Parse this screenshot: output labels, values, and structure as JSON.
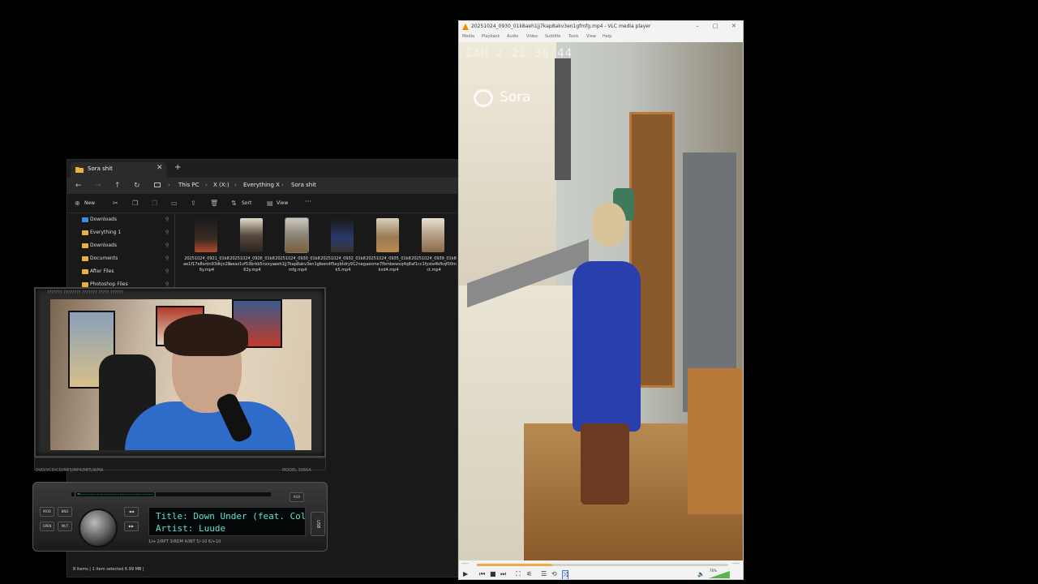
{
  "explorer": {
    "tab_title": "Sora shit",
    "close_glyph": "✕",
    "new_tab_glyph": "+",
    "breadcrumb": [
      "This PC",
      "X (X:)",
      "Everything X",
      "Sora shit"
    ],
    "toolbar": {
      "new": "New",
      "sort": "Sort",
      "view": "View",
      "more": "···"
    },
    "nav_items": [
      {
        "label": "Downloads",
        "icon": "download-icon"
      },
      {
        "label": "Everything 1",
        "icon": "folder-icon"
      },
      {
        "label": "Downloads",
        "icon": "folder-icon"
      },
      {
        "label": "Documents",
        "icon": "folder-icon"
      },
      {
        "label": "After Files",
        "icon": "folder-icon"
      },
      {
        "label": "Photoshop Files",
        "icon": "folder-icon"
      }
    ],
    "files": [
      {
        "name": "20251024_0921_01k8ae1f17e8srdn93dkjn286y.mp4"
      },
      {
        "name": "20251024_0926_01k8aeaz1vf53brkb5nxxya62y.mp4"
      },
      {
        "name": "20251024_0930_01k8aeh1jj7kap8akv3en1gfmfg.mp4"
      },
      {
        "name": "20251024_0932_01k8aendf5eybtdry912negk5.mp4"
      },
      {
        "name": "20251024_0935_01k8aesme7fbmbewxq4q8kvd4.mp4"
      },
      {
        "name": "20251024_0939_01k8af1cc1fyste4kfkqf00mct.mp4"
      }
    ],
    "status": "8 items  |  1 item selected  6.99 MB  |"
  },
  "stereo": {
    "header": "??????? ???????? ??????? ????? ??????",
    "model": "DVD/VCD/CD/MP3/MP4/MP5/WMA",
    "brand": "MODEL 3066A",
    "strip": "[=--------------------------------]",
    "title_line": "Title: Down Under (feat. Colin Hay)",
    "artist_line": "Artist: Luude",
    "row": "1/⏯   2/RPT   3/RDM   4/INT   5/-10   6/+10",
    "usb": "USB"
  },
  "vlc": {
    "title": "20251024_0930_01k8aeh1jj7kap8akv3en1gfmfg.mp4 - VLC media player",
    "menu": [
      "Media",
      "Playback",
      "Audio",
      "Video",
      "Subtitle",
      "Tools",
      "View",
      "Help"
    ],
    "cam_timestamp": "CAM 2 21:36:44",
    "watermark": "Sora",
    "seek_left": "--:--",
    "seek_right": "--:--",
    "progress": 0.3,
    "volume_label": "76%",
    "volume": 0.76
  },
  "colors": {
    "vlc_orange": "#f08a00",
    "screen_text": "#63dfd0",
    "folder": "#e8b23c"
  }
}
